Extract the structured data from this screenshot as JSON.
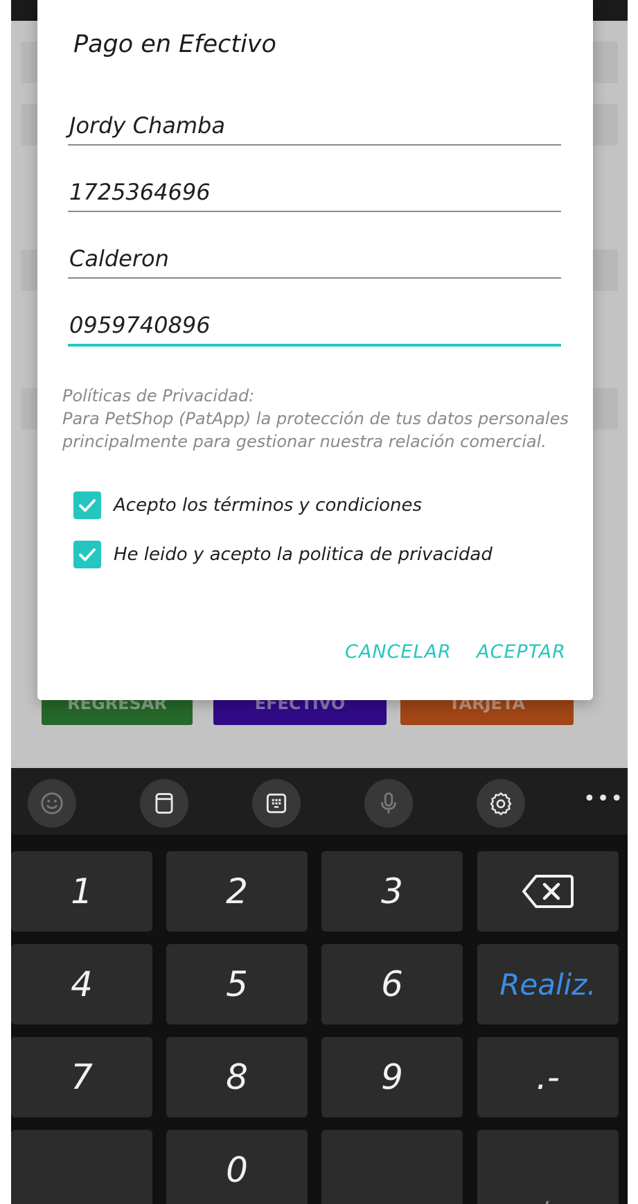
{
  "dialog": {
    "title": "Pago en Efectivo",
    "fields": [
      {
        "value": "Jordy Chamba"
      },
      {
        "value": "1725364696"
      },
      {
        "value": "Calderon"
      },
      {
        "value": "0959740896"
      }
    ],
    "privacy": {
      "heading": "Políticas de Privacidad:",
      "line1": "Para PetShop (PatApp) la protección de tus datos personales",
      "line2": "principalmente para gestionar nuestra relación comercial."
    },
    "checkboxes": [
      {
        "label": "Acepto los términos y condiciones",
        "checked": true
      },
      {
        "label": "He leido y acepto la politica de privacidad",
        "checked": true
      }
    ],
    "cancel_label": "CANCELAR",
    "accept_label": "ACEPTAR",
    "accent_color": "#26c6c0"
  },
  "background_buttons": [
    {
      "label": "REGRESAR",
      "color": "#2e7d32"
    },
    {
      "label": "EFECTIVO",
      "color": "#3a0ca3"
    },
    {
      "label": "TARJETA",
      "color": "#c2541a"
    }
  ],
  "keyboard": {
    "toolbar_icons": [
      "emoji-icon",
      "clipboard-icon",
      "keypad-icon",
      "microphone-icon",
      "settings-icon",
      "more-icon"
    ],
    "more_label": "•••",
    "keys": {
      "k1": "1",
      "k2": "2",
      "k3": "3",
      "k4": "4",
      "k5": "5",
      "k6": "6",
      "k7": "7",
      "k8": "8",
      "k9": "9",
      "k0": "0",
      "done": "Realiz.",
      "dot_dash": ".-",
      "comma": ","
    },
    "done_color": "#3a8ee6"
  }
}
